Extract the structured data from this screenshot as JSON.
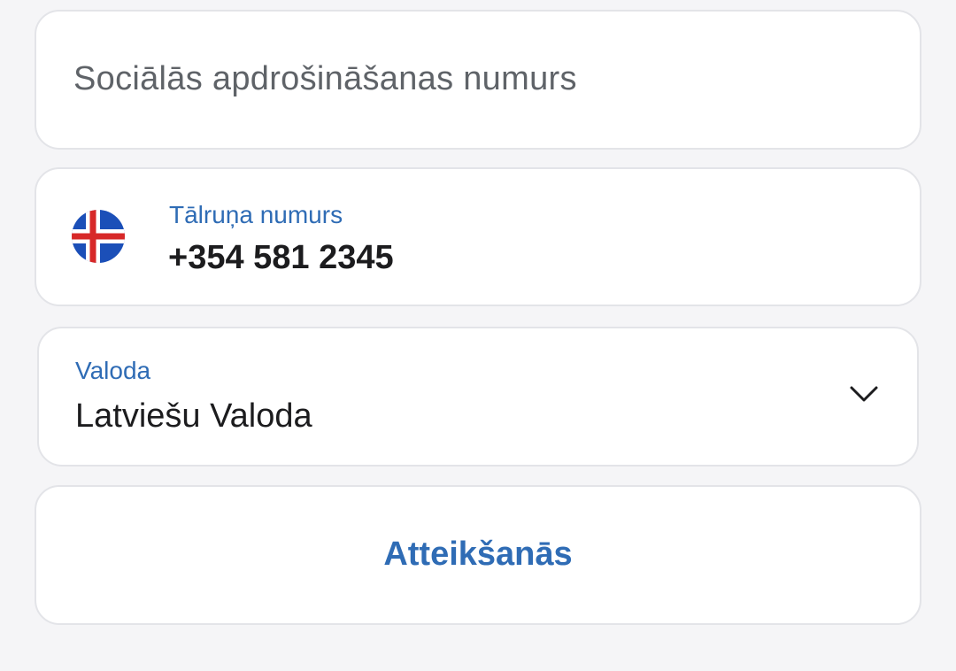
{
  "ssn_field": {
    "placeholder": "Sociālās apdrošināšanas numurs"
  },
  "phone_field": {
    "label": "Tālruņa numurs",
    "value": "+354 581 2345",
    "flag_icon": "iceland-flag-icon"
  },
  "language_field": {
    "label": "Valoda",
    "value": "Latviešu Valoda",
    "dropdown_icon": "chevron-down-icon"
  },
  "logout_button": {
    "label": "Atteikšanās"
  },
  "colors": {
    "accent": "#2f6cb5",
    "background": "#f5f5f7",
    "card": "#ffffff",
    "border": "#e3e4e8",
    "text": "#1c1c1e",
    "placeholder": "#5f6368"
  }
}
